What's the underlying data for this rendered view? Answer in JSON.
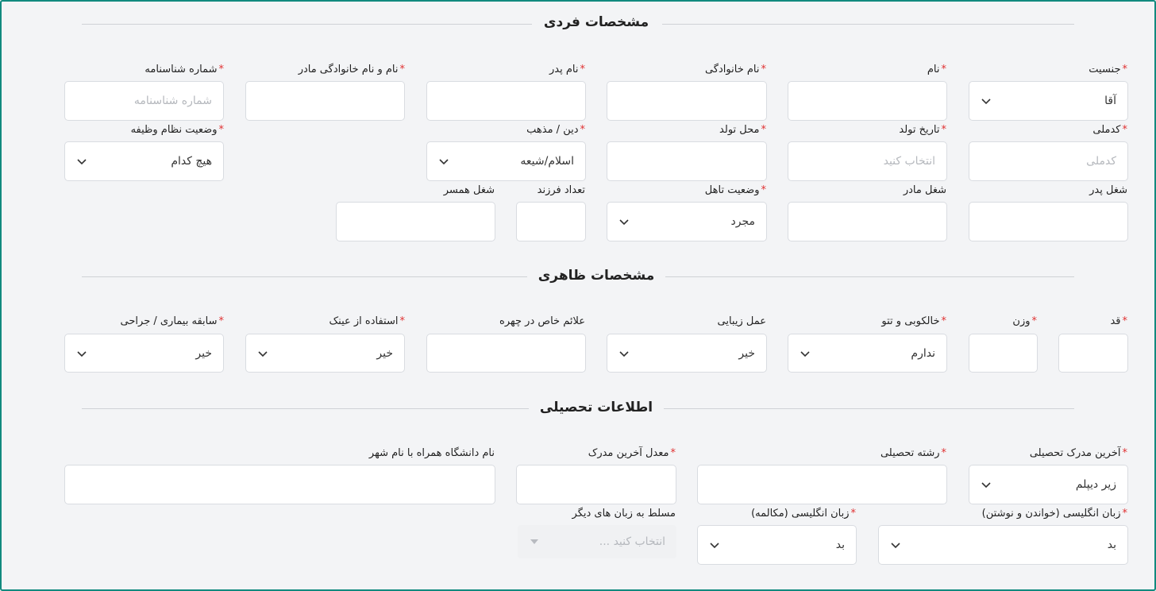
{
  "sections": {
    "personal": "مشخصات فردی",
    "appearance": "مشخصات ظاهری",
    "education": "اطلاعات تحصیلی"
  },
  "fields": {
    "gender": {
      "label": "جنسیت",
      "value": "آقا"
    },
    "first_name": {
      "label": "نام"
    },
    "last_name": {
      "label": "نام خانوادگی"
    },
    "father_name": {
      "label": "نام پدر"
    },
    "mother_name": {
      "label": "نام و نام خانوادگی مادر"
    },
    "id_number": {
      "label": "شماره شناسنامه",
      "placeholder": "شماره شناسنامه"
    },
    "national_code": {
      "label": "کدملی",
      "placeholder": "کدملی"
    },
    "birth_date": {
      "label": "تاریخ تولد",
      "placeholder": "انتخاب کنید"
    },
    "birth_place": {
      "label": "محل تولد"
    },
    "religion": {
      "label": "دین / مذهب",
      "value": "اسلام/شیعه"
    },
    "military": {
      "label": "وضعیت نظام وظیفه",
      "value": "هیچ کدام"
    },
    "father_job": {
      "label": "شغل پدر"
    },
    "mother_job": {
      "label": "شغل مادر"
    },
    "marital": {
      "label": "وضعیت تاهل",
      "value": "مجرد"
    },
    "children": {
      "label": "تعداد فرزند"
    },
    "spouse_job": {
      "label": "شغل همسر"
    },
    "height": {
      "label": "قد"
    },
    "weight": {
      "label": "وزن"
    },
    "tattoo": {
      "label": "خالکوبی و تتو",
      "value": "ندارم"
    },
    "cosmetic": {
      "label": "عمل زیبایی",
      "value": "خیر"
    },
    "face_marks": {
      "label": "علائم خاص در چهره"
    },
    "glasses": {
      "label": "استفاده از عینک",
      "value": "خیر"
    },
    "medical": {
      "label": "سابقه بیماری / جراحی",
      "value": "خیر"
    },
    "last_degree": {
      "label": "آخرین مدرک تحصیلی",
      "value": "زیر دیپلم"
    },
    "field_of_study": {
      "label": "رشته تحصیلی"
    },
    "gpa": {
      "label": "معدل آخرین مدرک"
    },
    "university": {
      "label": "نام دانشگاه همراه با نام شهر"
    },
    "english_rw": {
      "label": "زبان انگلیسی (خواندن و نوشتن)",
      "value": "بد"
    },
    "english_speak": {
      "label": "زبان انگلیسی (مکالمه)",
      "value": "بد"
    },
    "other_langs": {
      "label": "مسلط به زبان های دیگر",
      "placeholder": "انتخاب کنید ..."
    }
  },
  "required_mark": "*",
  "colors": {
    "border": "#118a7e",
    "required": "#e03131",
    "background": "#f3f4f6"
  }
}
